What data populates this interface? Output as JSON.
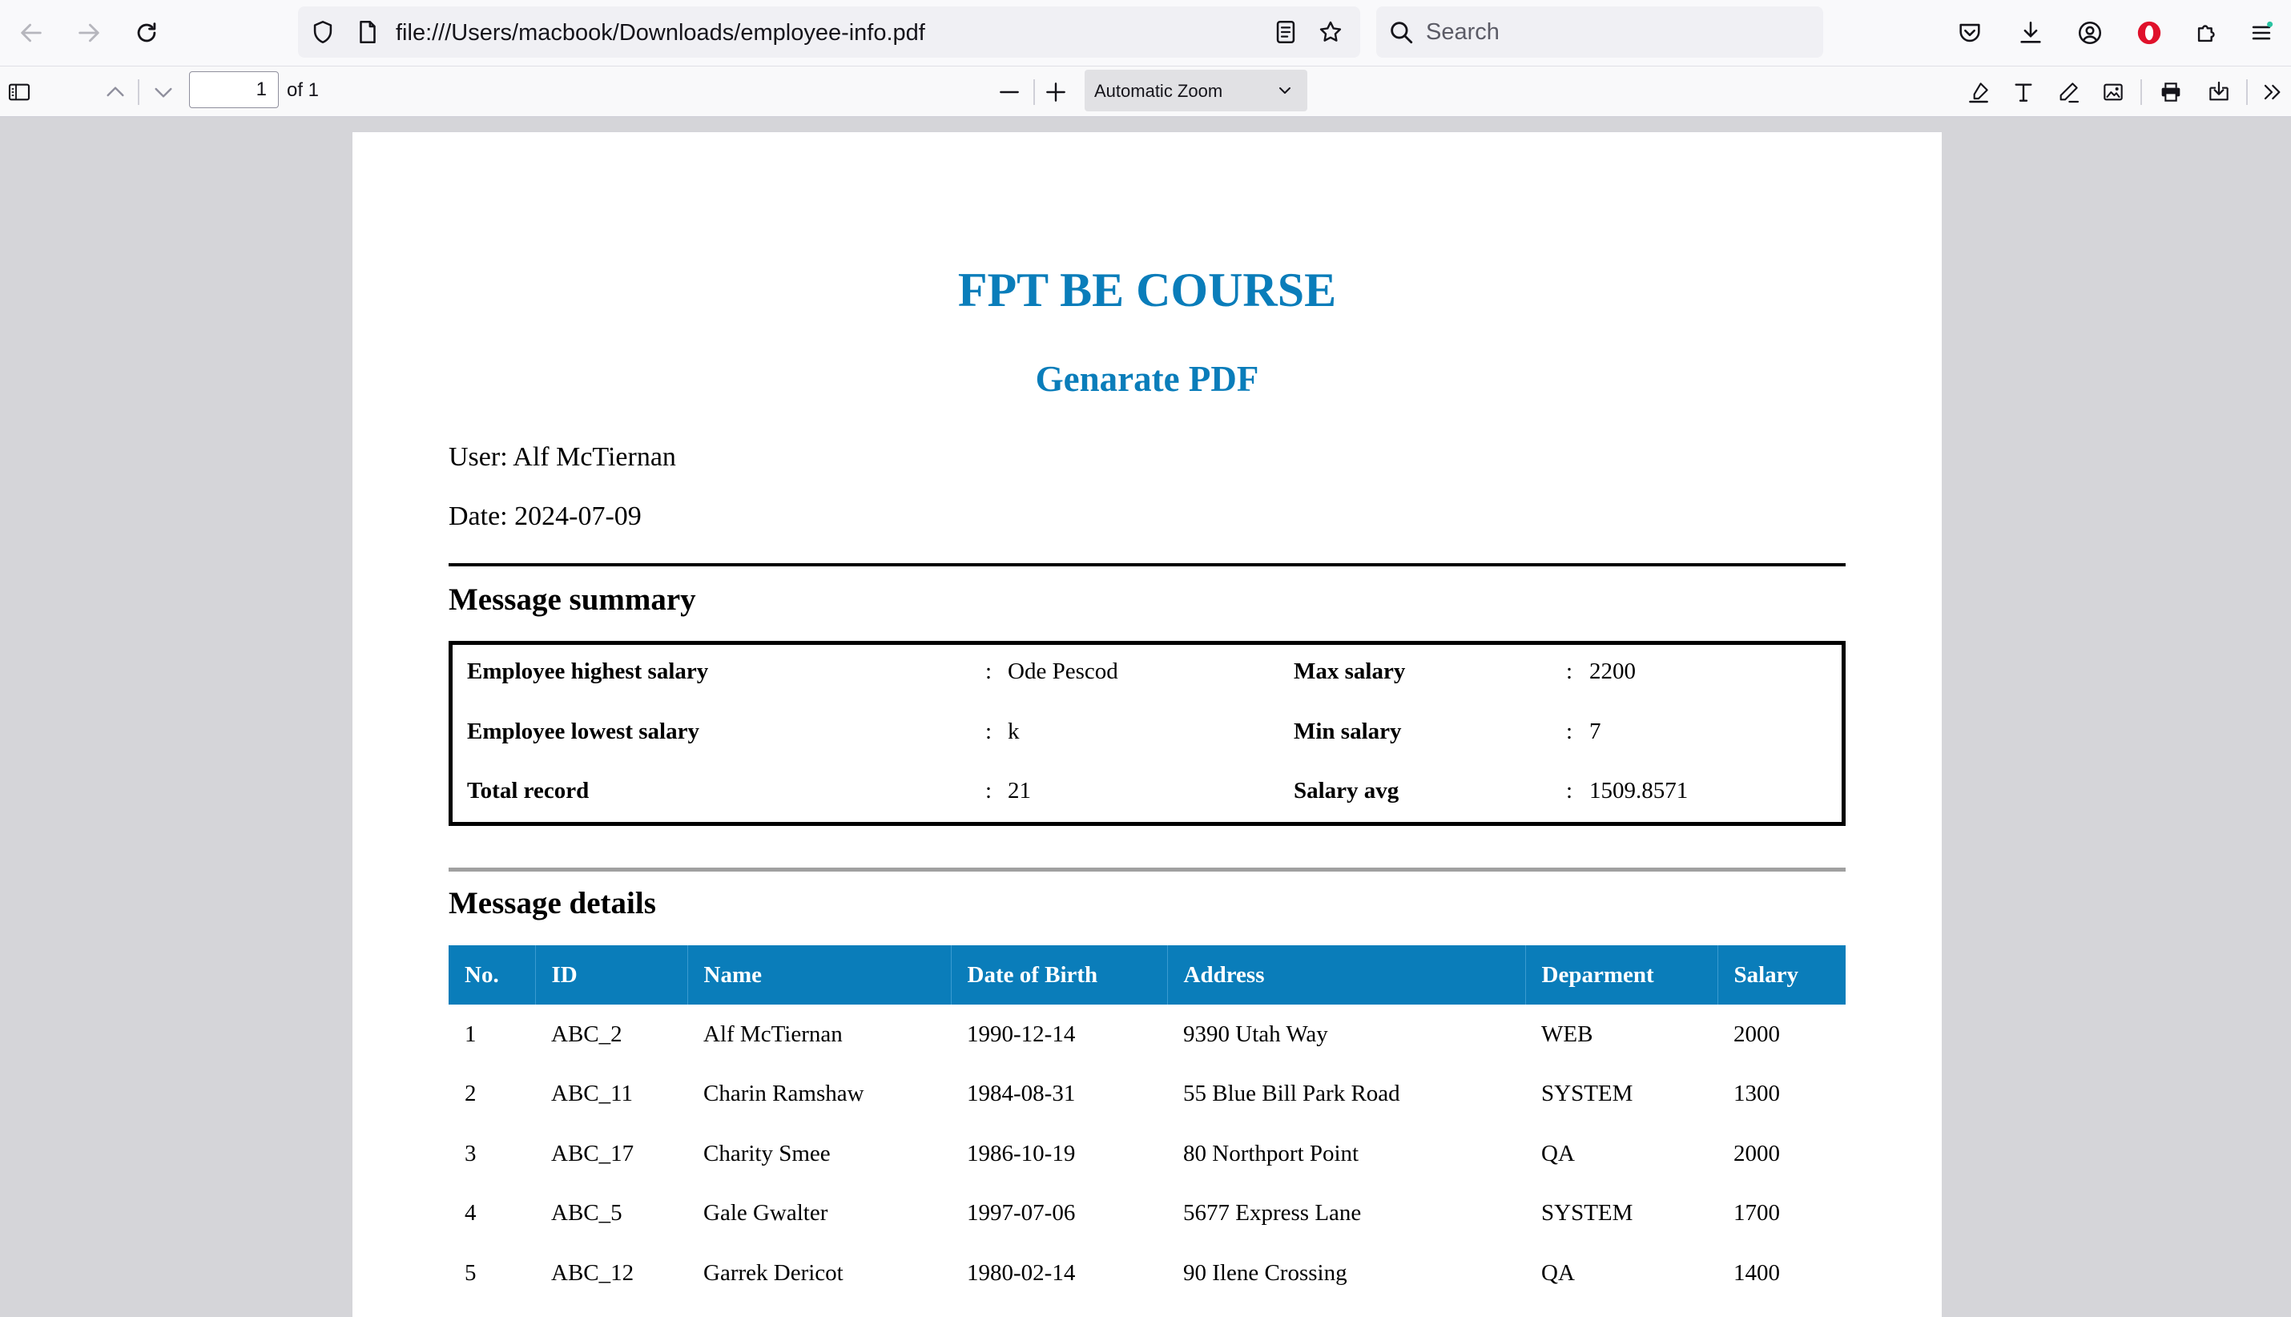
{
  "browser": {
    "url": "file:///Users/macbook/Downloads/employee-info.pdf",
    "search_placeholder": "Search"
  },
  "pdf_toolbar": {
    "page_number": "1",
    "page_of": "of 1",
    "zoom": "Automatic Zoom"
  },
  "doc": {
    "title": "FPT BE COURSE",
    "subtitle": "Genarate PDF",
    "user": "User: Alf McTiernan",
    "date": "Date: 2024-07-09",
    "summary_heading": "Message summary",
    "summary": [
      {
        "label": "Employee highest salary",
        "value": "Ode Pescod",
        "label2": "Max salary",
        "value2": "2200"
      },
      {
        "label": "Employee lowest salary",
        "value": "k",
        "label2": "Min salary",
        "value2": "7"
      },
      {
        "label": "Total record",
        "value": "21",
        "label2": "Salary avg",
        "value2": "1509.8571"
      }
    ],
    "separator": ":",
    "details_heading": "Message details",
    "table": {
      "headers": [
        "No.",
        "ID",
        "Name",
        "Date of Birth",
        "Address",
        "Deparment",
        "Salary"
      ],
      "rows": [
        [
          "1",
          "ABC_2",
          "Alf McTiernan",
          "1990-12-14",
          "9390 Utah Way",
          "WEB",
          "2000"
        ],
        [
          "2",
          "ABC_11",
          "Charin Ramshaw",
          "1984-08-31",
          "55 Blue Bill Park Road",
          "SYSTEM",
          "1300"
        ],
        [
          "3",
          "ABC_17",
          "Charity Smee",
          "1986-10-19",
          "80 Northport Point",
          "QA",
          "2000"
        ],
        [
          "4",
          "ABC_5",
          "Gale Gwalter",
          "1997-07-06",
          "5677 Express Lane",
          "SYSTEM",
          "1700"
        ],
        [
          "5",
          "ABC_12",
          "Garrek Dericot",
          "1980-02-14",
          "90 Ilene Crossing",
          "QA",
          "1400"
        ]
      ]
    }
  },
  "colors": {
    "accent": "#0a7dba",
    "opera_red": "#e0112b",
    "notification_dot": "#2ac3a2"
  }
}
